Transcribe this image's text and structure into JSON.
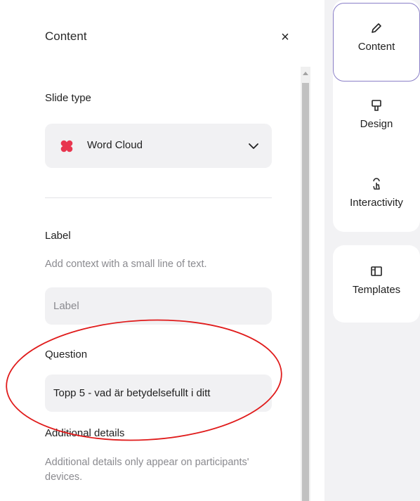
{
  "panel": {
    "title": "Content",
    "close_glyph": "×"
  },
  "slide_type": {
    "heading": "Slide type",
    "selected": "Word Cloud",
    "icon": "word-cloud-icon",
    "icon_color": "#e8364f"
  },
  "label_section": {
    "heading": "Label",
    "hint": "Add context with a small line of text.",
    "placeholder": "Label",
    "value": ""
  },
  "question_section": {
    "heading": "Question",
    "value": "Topp 5 - vad är betydelsefullt i ditt"
  },
  "additional_section": {
    "heading": "Additional details",
    "hint": "Additional details only appear on participants' devices."
  },
  "right_rail": {
    "items": [
      {
        "label": "Content",
        "icon": "pencil-icon",
        "active": true
      },
      {
        "label": "Design",
        "icon": "paint-roller-icon",
        "active": false
      },
      {
        "label": "Interactivity",
        "icon": "tap-gesture-icon",
        "active": false
      },
      {
        "label": "Templates",
        "icon": "templates-icon",
        "active": false
      }
    ]
  },
  "colors": {
    "annotation": "#e01b1b",
    "active_border": "#8a7fc7",
    "field_bg": "#f1f1f3"
  }
}
